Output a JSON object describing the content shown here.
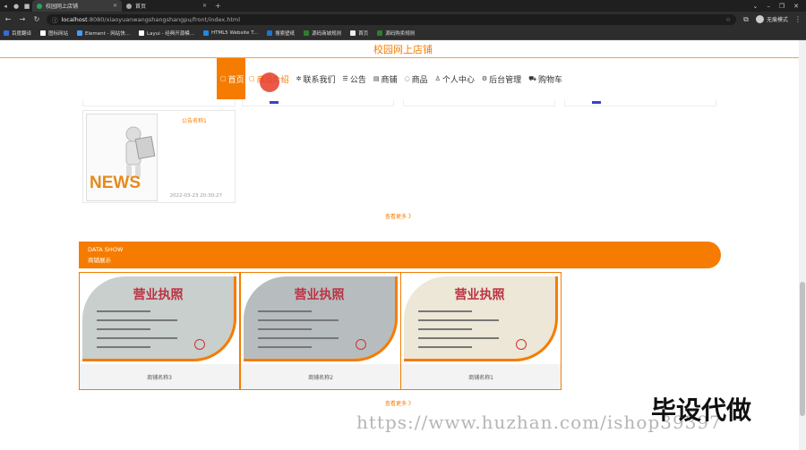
{
  "browser": {
    "tabs": [
      {
        "label": "校园网上店铺",
        "color": "#2aa35a"
      },
      {
        "label": "首页",
        "color": "#aaaaaa"
      }
    ],
    "url_host": "localhost",
    "url_path": ":8080/xiaoyuanwangshangshangpu/front/index.html",
    "profile_label": "无痕模式",
    "bookmarks": [
      {
        "label": "百度翻译",
        "color": "#3b6bd6"
      },
      {
        "label": "图标网站",
        "color": "#ffffff"
      },
      {
        "label": "Element - 网站快...",
        "color": "#409eff"
      },
      {
        "label": "Layui - 经典开源模...",
        "color": "#ffffff"
      },
      {
        "label": "HTML5 Website T...",
        "color": "#1e88e5"
      },
      {
        "label": "搜索壁纸",
        "color": "#1976d2"
      },
      {
        "label": "源码商城规则",
        "color": "#2e7d32"
      },
      {
        "label": "首页",
        "color": "#eeeeee"
      },
      {
        "label": "源码购卖规则",
        "color": "#2e7d32"
      }
    ]
  },
  "site": {
    "title": "校园网上店铺",
    "nav": [
      {
        "icon": "▢",
        "label": "首页"
      },
      {
        "icon": "▢",
        "label": "商品介绍"
      },
      {
        "icon": "✲",
        "label": "联系我们"
      },
      {
        "icon": "☰",
        "label": "公告"
      },
      {
        "icon": "▤",
        "label": "商铺"
      },
      {
        "icon": "◌",
        "label": "商品"
      },
      {
        "icon": "♙",
        "label": "个人中心"
      },
      {
        "icon": "⚙",
        "label": "后台管理"
      },
      {
        "icon": "⛟",
        "label": "购物车"
      }
    ]
  },
  "notice": {
    "image_text": "NEWS",
    "title": "公告名称1",
    "date": "2022-03-23 20:30:27",
    "more": "查看更多 》"
  },
  "shops": {
    "section_en": "DATA SHOW",
    "section_cn": "商铺展示",
    "items": [
      {
        "name": "商铺名称3",
        "license_title": "营业执照"
      },
      {
        "name": "商铺名称2",
        "license_title": "营业执照"
      },
      {
        "name": "商铺名称1",
        "license_title": "营业执照"
      }
    ],
    "more": "查看更多 》"
  },
  "watermark": {
    "url": "https://www.huzhan.com/ishop39397",
    "big": "毕设代做"
  },
  "colors": {
    "accent": "#f57c00"
  }
}
